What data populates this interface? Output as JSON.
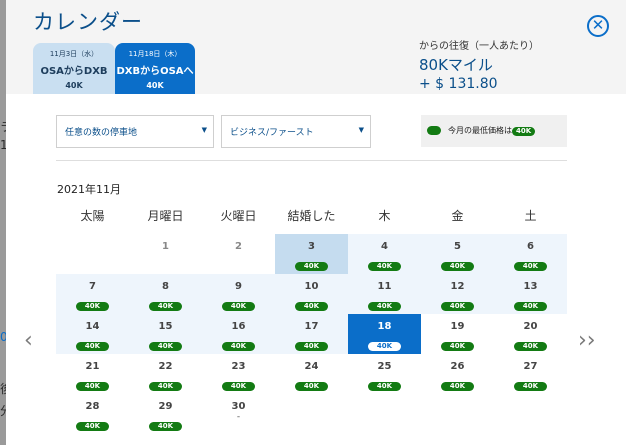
{
  "modal": {
    "title": "カレンダー",
    "close_icon": "close-circle-icon",
    "close_glyph": "✕"
  },
  "tabs": [
    {
      "date": "11月3日（水）",
      "route": "OSAからDXB",
      "price": "40K",
      "state": "inactive"
    },
    {
      "date": "11月18日（木）",
      "route": "DXBからOSAへ",
      "price": "40K",
      "state": "active"
    }
  ],
  "price_summary": {
    "note": "からの往復（一人あたり）",
    "miles": "80Kマイル",
    "tax": "+ $ 131.80"
  },
  "filters": {
    "stops": {
      "label": "任意の数の停車地",
      "arrow": "▼"
    },
    "cabin": {
      "label": "ビジネス/ファースト",
      "arrow": "▼"
    }
  },
  "legend": {
    "label": "今月の最低価格は",
    "tag": "40K",
    "color": "#137b13"
  },
  "calendar": {
    "month": "2021年11月",
    "prev_icon": "chevron-left-icon",
    "prev_glyph": "‹",
    "next_icon": "double-chevron-right-icon",
    "next_glyph": "››",
    "weekdays": [
      "太陽",
      "月曜日",
      "火曜日",
      "結婚した",
      "木",
      "金",
      "土"
    ],
    "days": [
      {
        "num": "1",
        "price": "",
        "state": "off"
      },
      {
        "num": "2",
        "price": "",
        "state": "off"
      },
      {
        "num": "3",
        "price": "40K",
        "state": "depart"
      },
      {
        "num": "4",
        "price": "40K",
        "state": "tint"
      },
      {
        "num": "5",
        "price": "40K",
        "state": "tint"
      },
      {
        "num": "6",
        "price": "40K",
        "state": "tint"
      },
      {
        "num": "7",
        "price": "40K",
        "state": "tint"
      },
      {
        "num": "8",
        "price": "40K",
        "state": "tint"
      },
      {
        "num": "9",
        "price": "40K",
        "state": "tint"
      },
      {
        "num": "10",
        "price": "40K",
        "state": "tint"
      },
      {
        "num": "11",
        "price": "40K",
        "state": "tint"
      },
      {
        "num": "12",
        "price": "40K",
        "state": "tint"
      },
      {
        "num": "13",
        "price": "40K",
        "state": "tint"
      },
      {
        "num": "14",
        "price": "40K",
        "state": "tint"
      },
      {
        "num": "15",
        "price": "40K",
        "state": "tint"
      },
      {
        "num": "16",
        "price": "40K",
        "state": "tint"
      },
      {
        "num": "17",
        "price": "40K",
        "state": "tint"
      },
      {
        "num": "18",
        "price": "40K",
        "state": "selected"
      },
      {
        "num": "19",
        "price": "40K",
        "state": "plain"
      },
      {
        "num": "20",
        "price": "40K",
        "state": "plain"
      },
      {
        "num": "21",
        "price": "40K",
        "state": "plain"
      },
      {
        "num": "22",
        "price": "40K",
        "state": "plain"
      },
      {
        "num": "23",
        "price": "40K",
        "state": "plain"
      },
      {
        "num": "24",
        "price": "40K",
        "state": "plain"
      },
      {
        "num": "25",
        "price": "40K",
        "state": "plain"
      },
      {
        "num": "26",
        "price": "40K",
        "state": "plain"
      },
      {
        "num": "27",
        "price": "40K",
        "state": "plain"
      },
      {
        "num": "28",
        "price": "40K",
        "state": "plain"
      },
      {
        "num": "29",
        "price": "40K",
        "state": "plain"
      },
      {
        "num": "30",
        "price": "-",
        "state": "plain"
      }
    ]
  },
  "colors": {
    "accent": "#0b6ec9",
    "title": "#0b4f8a",
    "price_badge": "#137b13",
    "row_tint": "#eef5fc",
    "depart_highlight": "#c5dcef"
  }
}
